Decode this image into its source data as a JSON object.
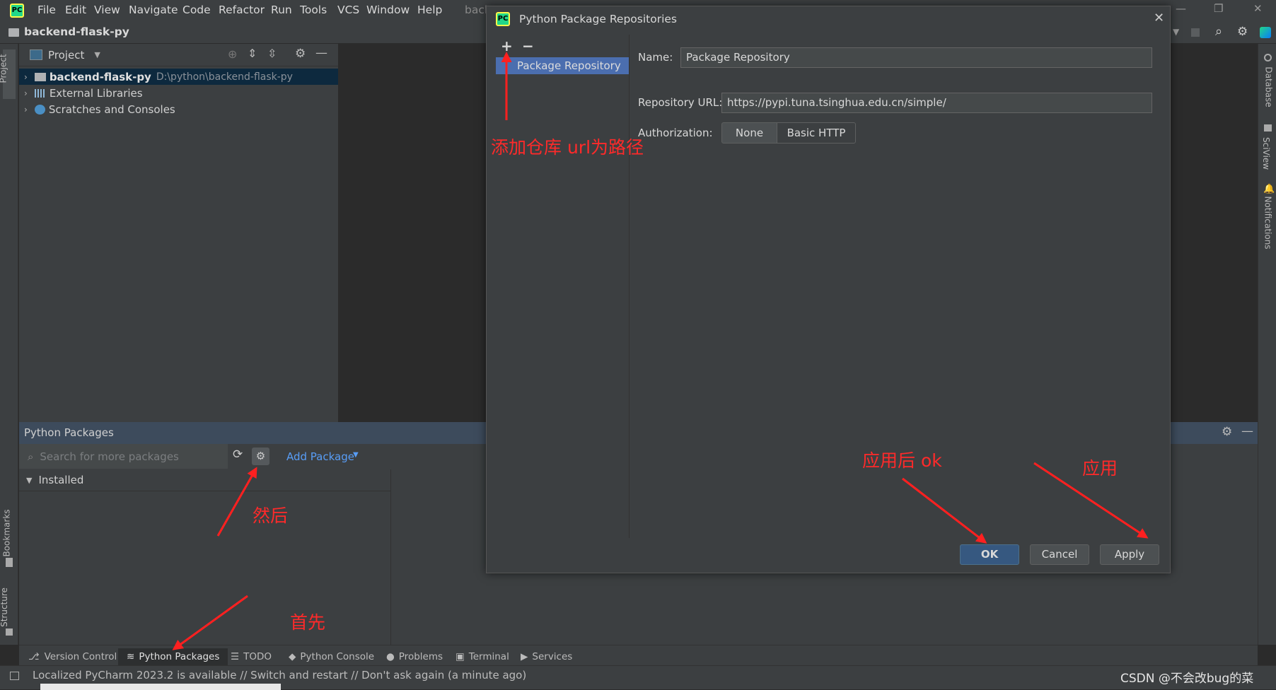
{
  "app": {
    "menu": [
      "File",
      "Edit",
      "View",
      "Navigate",
      "Code",
      "Refactor",
      "Run",
      "Tools",
      "VCS",
      "Window",
      "Help"
    ],
    "title_fragment": "bacl",
    "project_name": "backend-flask-py"
  },
  "left_strip": {
    "project": "Project",
    "bookmarks": "Bookmarks",
    "structure": "Structure"
  },
  "right_strip": {
    "database": "Database",
    "sciview": "SciView",
    "notifications": "Notifications"
  },
  "project_panel": {
    "header": "Project",
    "tree": [
      {
        "name": "backend-flask-py",
        "path": "D:\\python\\backend-flask-py"
      },
      {
        "name": "External Libraries"
      },
      {
        "name": "Scratches and Consoles"
      }
    ]
  },
  "packages_panel": {
    "title": "Python Packages",
    "search_placeholder": "Search for more packages",
    "add_package": "Add Package",
    "installed": "Installed"
  },
  "tool_tabs": [
    "Version Control",
    "Python Packages",
    "TODO",
    "Python Console",
    "Problems",
    "Terminal",
    "Services"
  ],
  "status": {
    "message": "Localized PyCharm 2023.2 is available // Switch and restart // Don't ask again (a minute ago)",
    "watermark": "CSDN @不会改bug的菜"
  },
  "dialog": {
    "title": "Python Package Repositories",
    "add": "+",
    "remove": "−",
    "repo_list": [
      "Package Repository"
    ],
    "name_label": "Name:",
    "name_value": "Package Repository",
    "url_label": "Repository URL:",
    "url_value": "https://pypi.tuna.tsinghua.edu.cn/simple/",
    "auth_label": "Authorization:",
    "auth_options": [
      "None",
      "Basic HTTP"
    ],
    "ok": "OK",
    "cancel": "Cancel",
    "apply": "Apply"
  },
  "annotations": {
    "add_repo": "添加仓库 url为路径",
    "then": "然后",
    "first": "首先",
    "apply_then_ok": "应用后 ok",
    "apply": "应用",
    "color": "#ff2a2a"
  }
}
